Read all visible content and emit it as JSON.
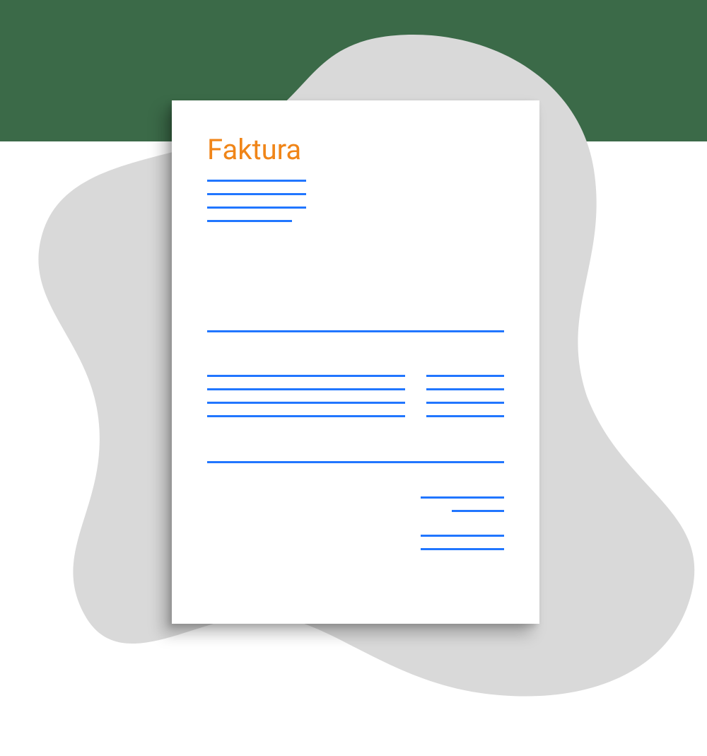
{
  "document": {
    "title": "Faktura"
  },
  "colors": {
    "accent_orange": "#f08518",
    "line_blue": "#2176ff",
    "background_green": "#3b6a48",
    "blob_gray": "#d9d9d9"
  }
}
